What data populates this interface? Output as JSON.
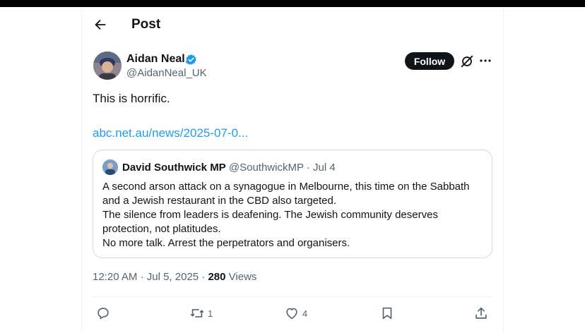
{
  "header": {
    "title": "Post"
  },
  "author": {
    "name": "Aidan Neal",
    "handle": "@AidanNeal_UK"
  },
  "follow_label": "Follow",
  "tweet": {
    "text": "This is horrific.",
    "link": "abc.net.au/news/2025-07-0..."
  },
  "quote": {
    "name": "David Southwick MP",
    "handle": "@SouthwickMP",
    "separator": "·",
    "date": "Jul 4",
    "lines": [
      "A second arson attack on a synagogue in Melbourne, this time on the Sabbath",
      "and a Jewish restaurant in the CBD also targeted.",
      "The silence from leaders is deafening. The Jewish community deserves",
      "protection, not platitudes.",
      "No more talk. Arrest the perpetrators and organisers."
    ]
  },
  "meta": {
    "time": "12:20 AM",
    "sep": "·",
    "date": "Jul 5, 2025",
    "views_count": "280",
    "views_label": "Views"
  },
  "actions": {
    "reposts": "1",
    "likes": "4"
  },
  "colors": {
    "link": "#1d9bf0",
    "verified": "#1d9bf0",
    "secondary": "#536471"
  }
}
